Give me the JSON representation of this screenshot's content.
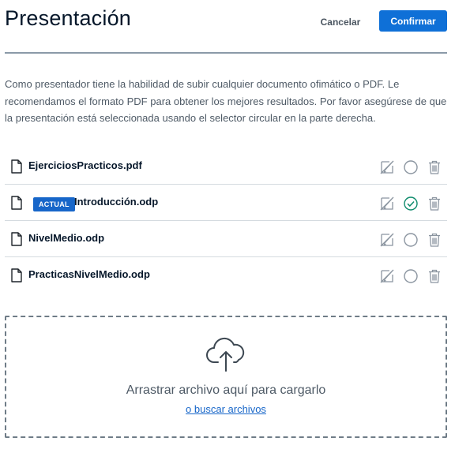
{
  "header": {
    "title": "Presentación",
    "cancel_label": "Cancelar",
    "confirm_label": "Confirmar"
  },
  "description": "Como presentador tiene la habilidad de subir cualquier documento ofimático o PDF. Le recomendamos el formato PDF para obtener los mejores resultados. Por favor asegúrese de que la presentación está seleccionada usando el selector circular en la parte derecha.",
  "files": [
    {
      "name": "EjerciciosPracticos.pdf",
      "badge": "",
      "selected": false
    },
    {
      "name": "Introducción.odp",
      "badge": "ACTUAL",
      "selected": true
    },
    {
      "name": "NivelMedio.odp",
      "badge": "",
      "selected": false
    },
    {
      "name": "PracticasNivelMedio.odp",
      "badge": "",
      "selected": false
    }
  ],
  "icons": {
    "file": "document-icon",
    "edit": "edit-disabled-icon",
    "select": "radio-circle-icon",
    "selected": "check-circle-icon",
    "delete": "trash-icon",
    "upload": "cloud-upload-icon"
  },
  "dropzone": {
    "text": "Arrastrar archivo aquí para cargarlo",
    "browse_label": "o buscar archivos"
  },
  "colors": {
    "accent": "#0f70d7",
    "badge": "#1766c9",
    "success": "#0c8a6b",
    "icon_gray": "#8b95a0"
  }
}
